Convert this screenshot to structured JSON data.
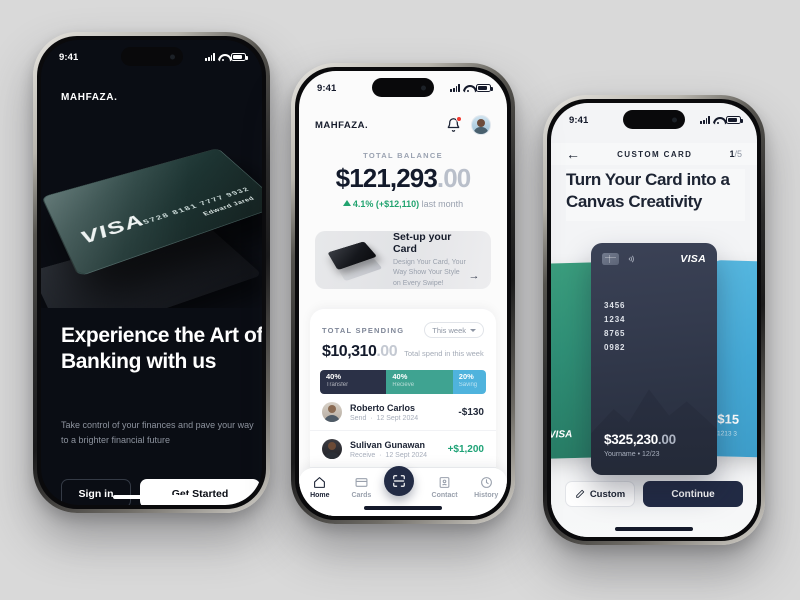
{
  "brand": "MAHFAZA.",
  "status_bar": {
    "time": "9:41",
    "signal_icon": "cellular-bars-icon",
    "wifi_icon": "wifi-icon",
    "battery_icon": "battery-icon"
  },
  "onboarding": {
    "brand": "MAHFAZA.",
    "card": {
      "network": "VISA",
      "number": "5728 8181 7777 9932",
      "holder": "Edward Jared"
    },
    "headline": "Experience the Art of Banking with us",
    "subtext": "Take control of your finances and pave your way to a brighter financial future",
    "sign_in_label": "Sign in",
    "get_started_label": "Get Started"
  },
  "home": {
    "brand": "MAHFAZA.",
    "notification_icon": "bell-icon",
    "avatar": "user-avatar",
    "balance_label": "TOTAL BALANCE",
    "balance_main": "$121,293",
    "balance_cents": ".00",
    "change_percent": "4.1% (+$12,110)",
    "change_suffix": " last month",
    "setup": {
      "title": "Set-up your Card",
      "description": "Design Your Card, Your Way Show Your Style on Every Swipe!",
      "arrow_icon": "arrow-right-icon"
    },
    "spending": {
      "label": "TOTAL SPENDING",
      "filter_label": "This week",
      "amount_main": "$10,310",
      "amount_cents": ".00",
      "note": "Total spend in this week",
      "segments": [
        {
          "percent": "40%",
          "label": "Transfer",
          "color": "#2b3147"
        },
        {
          "percent": "40%",
          "label": "Recieve",
          "color": "#3fa391"
        },
        {
          "percent": "20%",
          "label": "Saving",
          "color": "#4fb3dd"
        }
      ]
    },
    "transactions": [
      {
        "name": "Roberto Carlos",
        "type": "Send",
        "date": "12 Sept 2024",
        "amount": "-$130",
        "positive": false
      },
      {
        "name": "Sulivan Gunawan",
        "type": "Receive",
        "date": "12 Sept 2024",
        "amount": "+$1,200",
        "positive": true
      }
    ],
    "nav": [
      {
        "label": "Home",
        "icon": "home-icon",
        "active": true
      },
      {
        "label": "Cards",
        "icon": "card-icon",
        "active": false
      },
      {
        "label": "",
        "icon": "scan-icon",
        "active": false
      },
      {
        "label": "Contact",
        "icon": "contact-icon",
        "active": false
      },
      {
        "label": "History",
        "icon": "history-icon",
        "active": false
      }
    ]
  },
  "custom_card": {
    "back_icon": "arrow-left-icon",
    "title": "CUSTOM CARD",
    "step_current": "1",
    "step_sep": "/",
    "step_total": "5",
    "headline": "Turn Your Card into a Canvas Creativity",
    "main_card": {
      "chip_icon": "chip-icon",
      "contactless_icon": "contactless-icon",
      "network": "VISA",
      "numbers": [
        "3456",
        "1234",
        "8765",
        "0982"
      ],
      "amount_main": "$325,230",
      "amount_cents": ".00",
      "holder_line": "Yourname  •  12/23"
    },
    "left_card": {
      "network": "VISA",
      "color": "#3c9f7e"
    },
    "right_card": {
      "amount": "$15",
      "holder_line": "1213 3",
      "color": "#57b8e0"
    },
    "custom_label": "Custom",
    "custom_icon": "pencil-icon",
    "continue_label": "Continue"
  }
}
